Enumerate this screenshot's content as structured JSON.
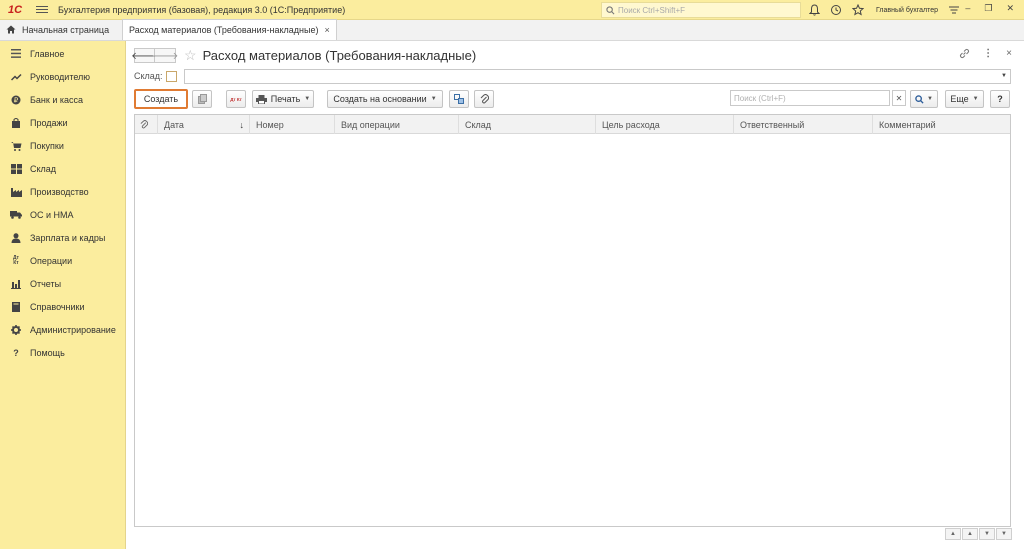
{
  "app": {
    "logo": "1С",
    "title": "Бухгалтерия предприятия (базовая), редакция 3.0  (1С:Предприятие)",
    "search_placeholder": "Поиск Ctrl+Shift+F",
    "user": "Главный бухгалтер",
    "window_buttons": [
      "–",
      "❐",
      "✕"
    ]
  },
  "tabs": {
    "home": "Начальная страница",
    "active": "Расход материалов (Требования-накладные)",
    "close": "×"
  },
  "sidebar": {
    "items": [
      {
        "label": "Главное",
        "icon": "menu-icon"
      },
      {
        "label": "Руководителю",
        "icon": "trend-icon"
      },
      {
        "label": "Банк и касса",
        "icon": "coin-icon"
      },
      {
        "label": "Продажи",
        "icon": "bag-icon"
      },
      {
        "label": "Покупки",
        "icon": "cart-icon"
      },
      {
        "label": "Склад",
        "icon": "warehouse-icon"
      },
      {
        "label": "Производство",
        "icon": "factory-icon"
      },
      {
        "label": "ОС и НМА",
        "icon": "truck-icon"
      },
      {
        "label": "Зарплата и кадры",
        "icon": "person-icon"
      },
      {
        "label": "Операции",
        "icon": "dt-kt-icon"
      },
      {
        "label": "Отчеты",
        "icon": "bar-chart-icon"
      },
      {
        "label": "Справочники",
        "icon": "book-icon"
      },
      {
        "label": "Администрирование",
        "icon": "gear-icon"
      },
      {
        "label": "Помощь",
        "icon": "question-icon"
      }
    ]
  },
  "form": {
    "title": "Расход материалов (Требования-накладные)",
    "sklad_label": "Склад:",
    "sklad_value": ""
  },
  "toolbar": {
    "create": "Создать",
    "dt_kt": "Дт Кт",
    "print": "Печать",
    "create_based_on": "Создать на основании",
    "search_placeholder": "Поиск (Ctrl+F)",
    "more": "Еще",
    "help": "?"
  },
  "table": {
    "columns": [
      "",
      "Дата",
      "Номер",
      "Вид операции",
      "Склад",
      "Цель расхода",
      "Ответственный",
      "Комментарий"
    ],
    "sort_indicator": "↓",
    "rows": []
  }
}
